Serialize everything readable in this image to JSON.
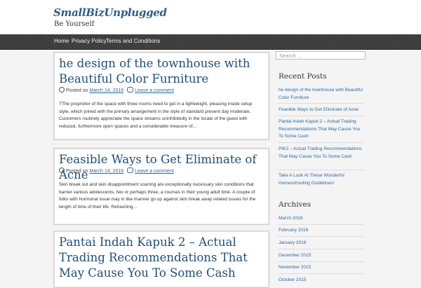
{
  "site": {
    "title": "SmallBizUnplugged",
    "tagline": "Be Yourself"
  },
  "nav": [
    "Home",
    "Privacy Policy",
    "Terms and Conditions"
  ],
  "posts": [
    {
      "title": "he design of the townhouse with Beautiful Color Furniture",
      "posted_on": "Posted on",
      "date": "March 14, 2016",
      "comment_link": "Leave a comment",
      "excerpt": "TThe proprietor of the space with three rooms need to get in a lightweight, pleasing inside setup style, which joined with the primary arrangement in the style of standard present day moderate. Customers routinely appreciate the space streams uninhibitedly in the locale of the guest with reduced, furthermore open spaces and a considerable measure of…"
    },
    {
      "title": "Feasible Ways to Get Eliminate of Acne",
      "posted_on": "Posted on",
      "date": "March 14, 2016",
      "comment_link": "Leave a comment",
      "excerpt": "Skin break out and skin disappointment scarring are exceptionally necessary skin conditions that barrier various adolescents, two or perhaps three, a courses in their young adult time. A couple of folks with hormonal issue may in like manner go up against skin break away related issues for the length of time of their life. Rehashing…"
    },
    {
      "title": "Pantai Indah Kapuk 2 – Actual Trading Recommendations That May Cause You To Some Cash"
    }
  ],
  "sidebar": {
    "search_placeholder": "Search …",
    "recent_title": "Recent Posts",
    "recent": [
      "he design of the townhouse with Beautiful Color Furniture",
      "Feasible Ways to Get Eliminate of Acne",
      "Pantai Indah Kapuk 2 – Actual Trading Recommendations That May Cause You To Some Cash",
      "PIK2 – Actual Trading Recommendations That May Cause You To Some Cash",
      "Take A Look At These Wonderful Homeschooling Guidelines!"
    ],
    "archives_title": "Archives",
    "archives": [
      "March 2016",
      "February 2016",
      "January 2016",
      "December 2015",
      "November 2015",
      "October 2015"
    ]
  }
}
